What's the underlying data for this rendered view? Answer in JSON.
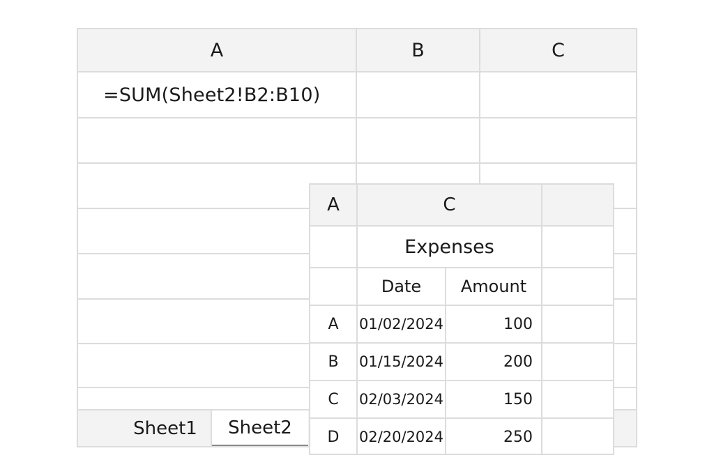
{
  "sheet1": {
    "columns": [
      "A",
      "B",
      "C"
    ],
    "formula_cell": "=SUM(Sheet2!B2:B10)"
  },
  "tabs": [
    {
      "label": "Sheet1",
      "active": false
    },
    {
      "label": "Sheet2",
      "active": true
    }
  ],
  "sheet2": {
    "columns": [
      "A",
      "C",
      ""
    ],
    "title": "Expenses",
    "headers": [
      "Date",
      "Amount"
    ],
    "rows": [
      {
        "label": "A",
        "date": "01/02/2024",
        "amount": "100"
      },
      {
        "label": "B",
        "date": "01/15/2024",
        "amount": "200"
      },
      {
        "label": "C",
        "date": "02/03/2024",
        "amount": "150"
      },
      {
        "label": "D",
        "date": "02/20/2024",
        "amount": "250"
      }
    ]
  },
  "colors": {
    "gridline": "#dcdcdc",
    "header_bg": "#f3f3f3",
    "active_tab_underline": "#8a8a8a"
  }
}
